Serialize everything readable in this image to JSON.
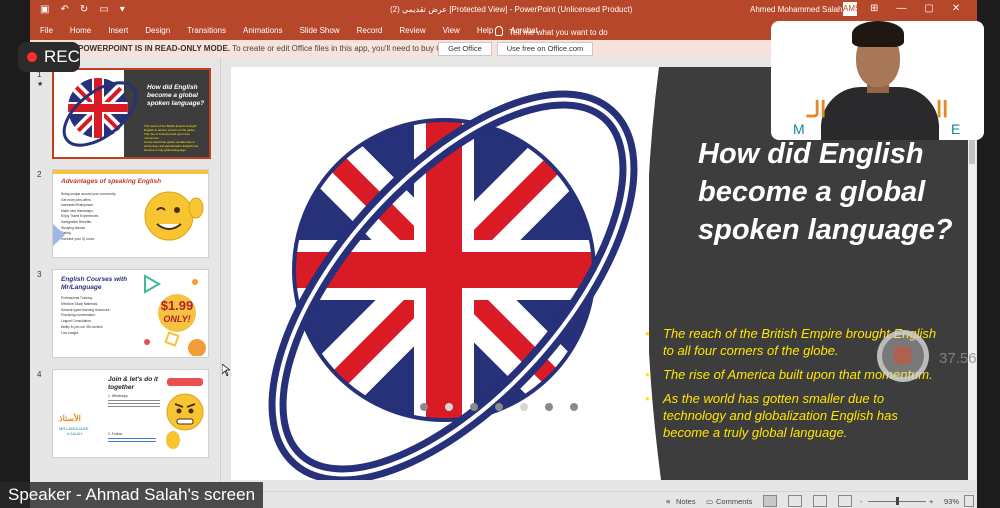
{
  "titlebar": {
    "title": "عرض تقديمي (2) [Protected View] - PowerPoint (Unlicensed Product)",
    "user": "Ahmed Mohammed Salah",
    "avatar_initials": "AMS"
  },
  "ribbon": {
    "tabs": [
      "File",
      "Home",
      "Insert",
      "Design",
      "Transitions",
      "Animations",
      "Slide Show",
      "Record",
      "Review",
      "View",
      "Help",
      "Acrobat"
    ],
    "tell_me": "Tell me what you want to do"
  },
  "message_bar": {
    "bold_text": "POWERPOINT IS IN READ-ONLY MODE.",
    "text": "To create or edit Office files in this app, you'll need to buy Office.",
    "get_office": "Get Office",
    "use_free": "Use free on Office.com"
  },
  "thumbnails": [
    {
      "num": "1",
      "title": "How did English become a global spoken language?",
      "bullets": [
        "The reach of the British Empire brought English to all four corners of the globe.",
        "The rise of America built upon that momentum.",
        "As the world has gotten smaller due to technology and globalization English has become a truly global language."
      ]
    },
    {
      "num": "2",
      "title": "Advantages of speaking English",
      "bullets": [
        "Being unique around your community.",
        "Get more jobs offers.",
        "Increased Brainpower.",
        "Make new friendships.",
        "Enjoy Travel Experiences.",
        "Immigration Benefits.",
        "Studying abroad.",
        "Dating.",
        "Increase your IQ score."
      ]
    },
    {
      "num": "3",
      "title": "English Courses with Mr/Language",
      "bullets": [
        "Professional Tutoring.",
        "Effective Study Materials.",
        "Several-typed learning resources.",
        "Practicing conversation.",
        "Lingual Consultation.",
        "Ability to join our 3M content.",
        "Low budget."
      ],
      "price": "$1.99",
      "price_note": "ONLY!"
    },
    {
      "num": "4",
      "title": "Join & let's do it together",
      "items": [
        "1. Whatsapp",
        "2. Follow"
      ],
      "brand_ar": "الأستاذ",
      "brand_en": "MR.LANGUAGE",
      "brand_sub": "A.SALAH"
    }
  ],
  "slide": {
    "title": "How did English become a global spoken language?",
    "bullets": [
      "The reach of the British Empire brought English to all four corners of the globe.",
      "The rise of America built upon that momentum.",
      "As the world has gotten smaller due to technology and globalization English has become a truly global language."
    ]
  },
  "statusbar": {
    "notes": "Notes",
    "comments": "Comments",
    "zoom_minus": "-",
    "zoom_plus": "+",
    "zoom": "93%"
  },
  "overlay": {
    "rec": "REC",
    "timer": "37.56",
    "speaker": "Speaker - Ahmad Salah's screen",
    "webcam_logo_m": "M",
    "webcam_logo_e": "E",
    "webcam_logo_ar_left": "الـ",
    "webcam_logo_ar_right": "اا"
  },
  "colors": {
    "accent": "#b7472a",
    "slide_dark": "#3d3d3d",
    "bullet_yellow": "#ffe600",
    "flag_blue": "#26317a",
    "flag_red": "#d81b24"
  }
}
